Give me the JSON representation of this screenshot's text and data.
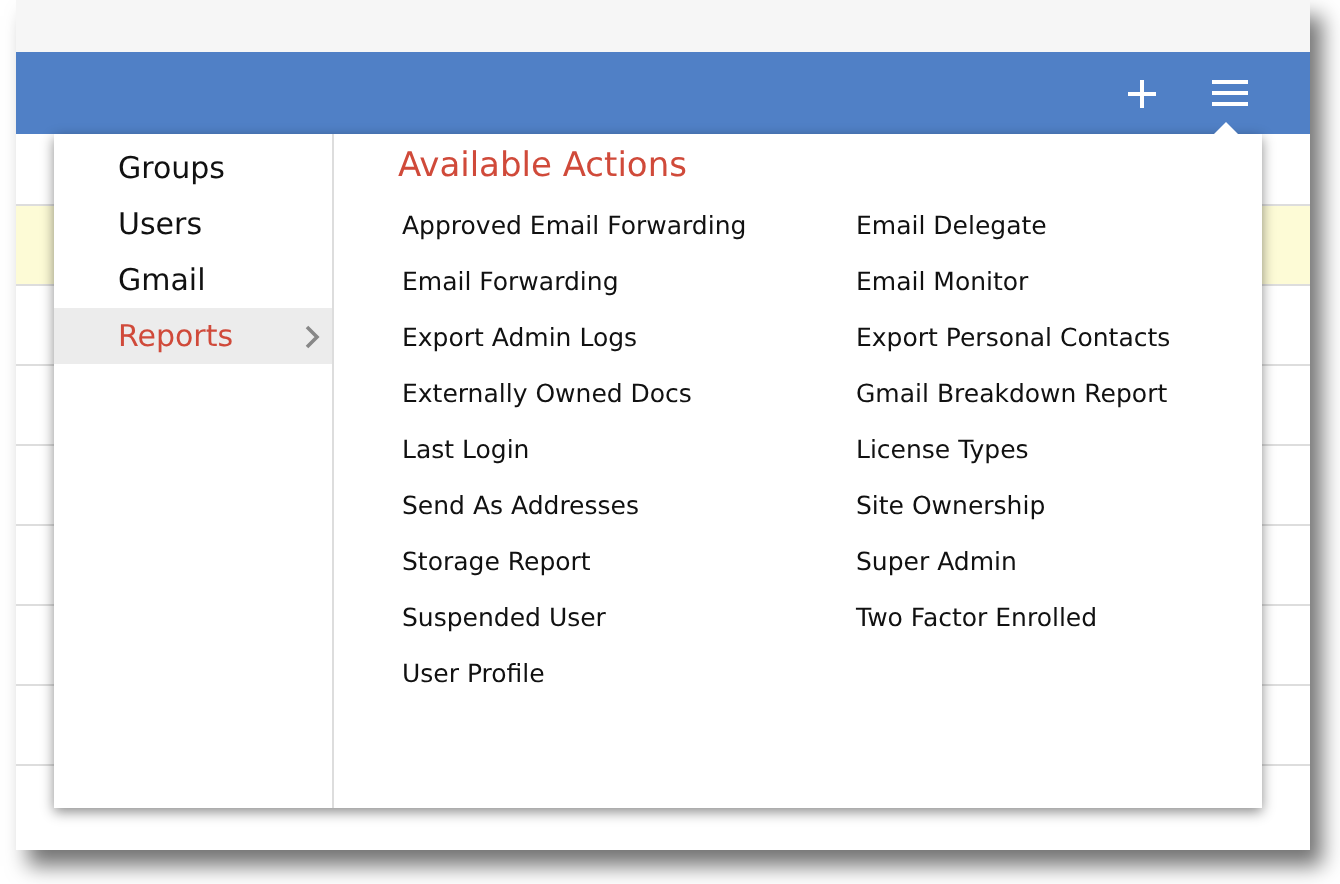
{
  "categories": [
    {
      "label": "Groups",
      "selected": false
    },
    {
      "label": "Users",
      "selected": false
    },
    {
      "label": "Gmail",
      "selected": false
    },
    {
      "label": "Reports",
      "selected": true
    }
  ],
  "actions_title": "Available Actions",
  "actions": [
    "Approved Email Forwarding",
    "Email Forwarding",
    "Export Admin Logs",
    "Externally Owned Docs",
    "Last Login",
    "Send As Addresses",
    "Storage Report",
    "Suspended User",
    "User Profile",
    "Email Delegate",
    "Email Monitor",
    "Export Personal Contacts",
    "Gmail Breakdown Report",
    "License Types",
    "Site Ownership",
    "Super Admin",
    "Two Factor Enrolled"
  ],
  "rows": [
    {
      "highlighted": false
    },
    {
      "highlighted": true
    },
    {
      "highlighted": false
    },
    {
      "highlighted": false
    },
    {
      "highlighted": false
    },
    {
      "highlighted": false
    },
    {
      "highlighted": false
    },
    {
      "highlighted": false
    }
  ]
}
